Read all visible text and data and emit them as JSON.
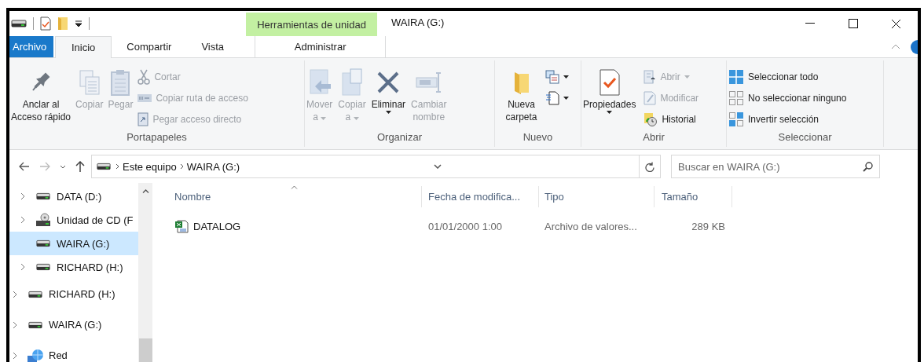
{
  "title_bar": {
    "title": "WAIRA (G:)",
    "context_group": "Herramientas de unidad"
  },
  "ribbon_tabs": [
    {
      "label": "Archivo",
      "kind": "file",
      "selected": false
    },
    {
      "label": "Inicio",
      "kind": "tab",
      "selected": true
    },
    {
      "label": "Compartir",
      "kind": "tab",
      "selected": false
    },
    {
      "label": "Vista",
      "kind": "tab",
      "selected": false
    },
    {
      "label": "Administrar",
      "kind": "context",
      "selected": false
    }
  ],
  "ribbon_groups": [
    {
      "label": "Portapapeles",
      "columns": [
        {
          "kind": "large",
          "items": [
            {
              "label": "Anclar al\nAcceso rápido",
              "disabled": false,
              "dropdown": false
            }
          ]
        },
        {
          "kind": "large",
          "items": [
            {
              "label": "Copiar",
              "disabled": true,
              "dropdown": false
            }
          ]
        },
        {
          "kind": "large",
          "items": [
            {
              "label": "Pegar",
              "disabled": true,
              "dropdown": false
            }
          ]
        },
        {
          "kind": "small",
          "items": [
            {
              "label": "Cortar",
              "disabled": true,
              "dropdown": false
            },
            {
              "label": "Copiar ruta de acceso",
              "disabled": true,
              "dropdown": false
            },
            {
              "label": "Pegar acceso directo",
              "disabled": true,
              "dropdown": false
            }
          ]
        }
      ]
    },
    {
      "label": "Organizar",
      "columns": [
        {
          "kind": "large",
          "items": [
            {
              "label": "Mover\na",
              "disabled": true,
              "dropdown": true
            }
          ]
        },
        {
          "kind": "large",
          "items": [
            {
              "label": "Copiar\na",
              "disabled": true,
              "dropdown": true
            }
          ]
        },
        {
          "kind": "large",
          "items": [
            {
              "label": "Eliminar",
              "disabled": false,
              "dropdown": true
            }
          ]
        },
        {
          "kind": "large",
          "items": [
            {
              "label": "Cambiar\nnombre",
              "disabled": true,
              "dropdown": false
            }
          ]
        }
      ]
    },
    {
      "label": "Nuevo",
      "columns": [
        {
          "kind": "large",
          "items": [
            {
              "label": "Nueva\ncarpeta",
              "disabled": false,
              "dropdown": false
            }
          ]
        },
        {
          "kind": "small",
          "items": [
            {
              "disabled": false,
              "dropdown": true
            },
            {
              "disabled": false,
              "dropdown": true
            }
          ]
        }
      ]
    },
    {
      "label": "Abrir",
      "columns": [
        {
          "kind": "large",
          "items": [
            {
              "label": "Propiedades",
              "disabled": false,
              "dropdown": true
            }
          ]
        },
        {
          "kind": "small",
          "items": [
            {
              "label": "Abrir",
              "disabled": true,
              "dropdown": true
            },
            {
              "label": "Modificar",
              "disabled": true,
              "dropdown": false
            },
            {
              "label": "Historial",
              "disabled": false,
              "dropdown": false
            }
          ]
        }
      ]
    },
    {
      "label": "Seleccionar",
      "columns": [
        {
          "kind": "small",
          "items": [
            {
              "label": "Seleccionar todo",
              "disabled": false,
              "dropdown": false
            },
            {
              "label": "No seleccionar ninguno",
              "disabled": false,
              "dropdown": false
            },
            {
              "label": "Invertir selección",
              "disabled": false,
              "dropdown": false
            }
          ]
        }
      ]
    }
  ],
  "address_bar": {
    "path": [
      "Este equipo",
      "WAIRA (G:)"
    ],
    "search": {
      "placeholder": "Buscar en WAIRA (G:)"
    }
  },
  "nav_tree": [
    {
      "children": [
        {
          "label": "DATA (D:)",
          "kind": "drive",
          "expandable": true,
          "selected": false
        },
        {
          "label": "Unidad de CD (F",
          "kind": "cd",
          "expandable": true,
          "selected": false
        },
        {
          "label": "WAIRA (G:)",
          "kind": "drive",
          "expandable": false,
          "selected": true
        },
        {
          "label": "RICHARD (H:)",
          "kind": "drive",
          "expandable": true,
          "selected": false
        }
      ]
    },
    {
      "label": "RICHARD (H:)",
      "kind": "drive",
      "expandable": true,
      "selected": false
    },
    {
      "label": "WAIRA (G:)",
      "kind": "drive",
      "expandable": true,
      "selected": false
    },
    {
      "label": "Red",
      "kind": "network",
      "expandable": true,
      "selected": false
    }
  ],
  "file_list": {
    "columns": [
      {
        "label": "Nombre",
        "sorted": true
      },
      {
        "label": "Fecha de modifica...",
        "sorted": false
      },
      {
        "label": "Tipo",
        "sorted": false
      },
      {
        "label": "Tamaño",
        "sorted": false
      }
    ],
    "rows": [
      {
        "kind": "spreadsheet",
        "cells": [
          "DATALOG",
          "01/01/2000 1:00",
          "Archivo de valores...",
          "289 KB"
        ],
        "selected": false
      }
    ]
  }
}
